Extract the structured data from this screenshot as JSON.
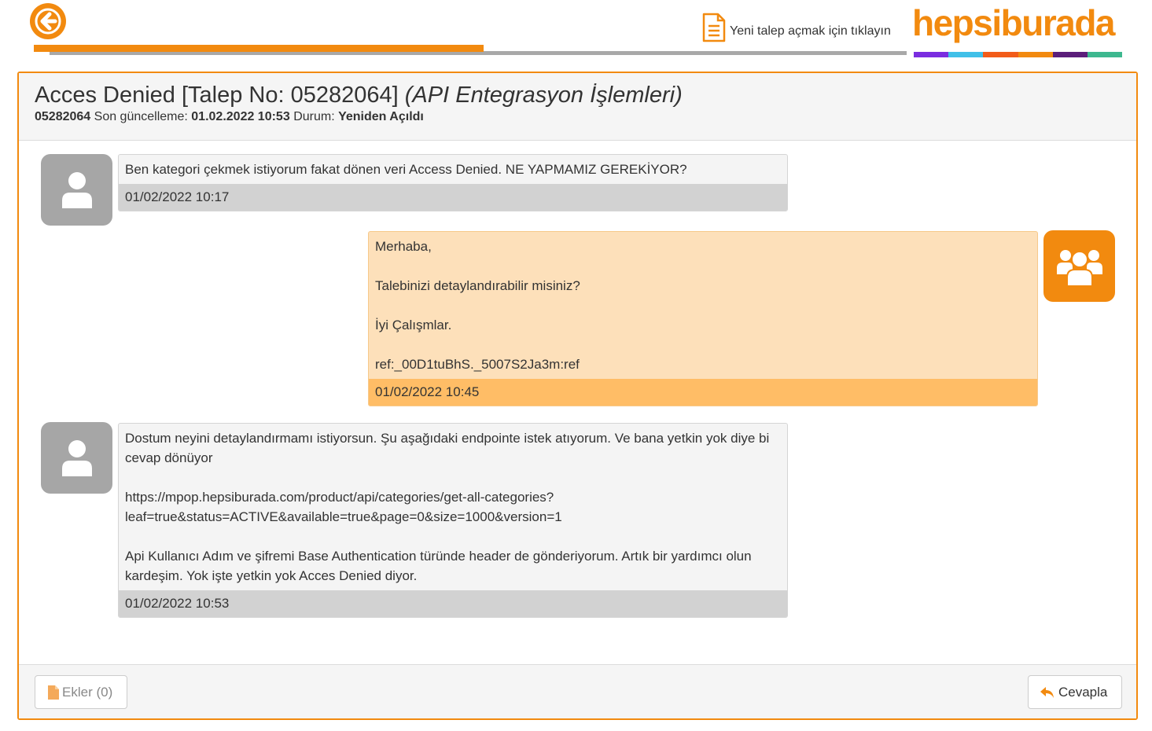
{
  "header": {
    "new_request_label": "Yeni talep açmak için tıklayın",
    "brand_name": "hepsiburada",
    "brand_colors": [
      "#7a2de0",
      "#40c0e8",
      "#f25c19",
      "#f28a0f",
      "#5b1e7a",
      "#3db88f"
    ],
    "accent": "#f28a0f",
    "progress": 0.5
  },
  "ticket": {
    "title": "Acces Denied [Talep No: 05282064]",
    "category": "(API Entegrasyon İşlemleri)",
    "number": "05282064",
    "updated_label": "Son güncelleme:",
    "updated_value": "01.02.2022 10:53",
    "status_label": "Durum:",
    "status_value": "Yeniden Açıldı"
  },
  "messages": [
    {
      "sender": "user",
      "text": "Ben kategori çekmek istiyorum fakat dönen veri Access Denied. NE YAPMAMIZ GEREKİYOR?",
      "time": "01/02/2022 10:17"
    },
    {
      "sender": "agent",
      "text": "Merhaba,\n\nTalebinizi detaylandırabilir misiniz?\n\nİyi Çalışmlar.\n\nref:_00D1tuBhS._5007S2Ja3m:ref",
      "time": "01/02/2022 10:45"
    },
    {
      "sender": "user",
      "text": "Dostum neyini detaylandırmamı istiyorsun. Şu aşağıdaki endpointe istek atıyorum. Ve bana yetkin yok diye bi cevap dönüyor\n\nhttps://mpop.hepsiburada.com/product/api/categories/get-all-categories?\nleaf=true&status=ACTIVE&available=true&page=0&size=1000&version=1\n\nApi Kullanıcı Adım ve şifremi Base Authentication türünde header de gönderiyorum. Artık bir yardımcı olun kardeşim. Yok işte yetkin yok Acces Denied diyor.",
      "time": "01/02/2022 10:53"
    }
  ],
  "footer": {
    "attachments_label": "Ekler (0)",
    "reply_label": "Cevapla"
  }
}
